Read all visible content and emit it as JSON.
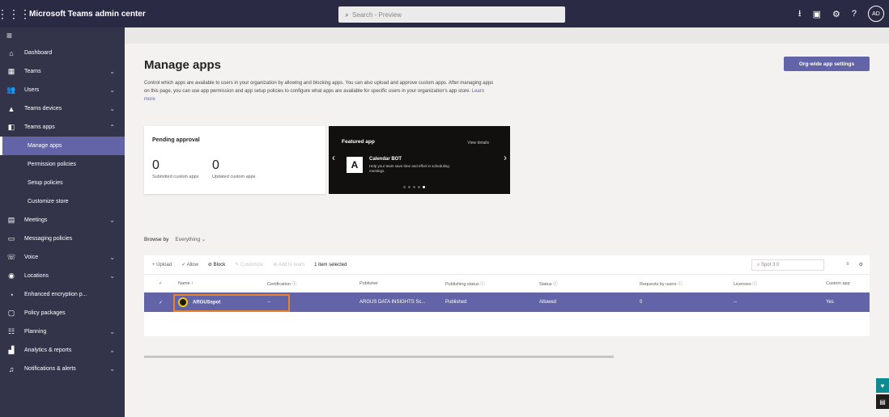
{
  "topbar": {
    "title": "Microsoft Teams admin center",
    "search_placeholder": "Search - Preview",
    "avatar_initials": "AD"
  },
  "sidebar": {
    "items": [
      {
        "label": "Dashboard",
        "icon": "home-icon"
      },
      {
        "label": "Teams",
        "icon": "teams-icon",
        "chevron": true
      },
      {
        "label": "Users",
        "icon": "users-icon",
        "chevron": true
      },
      {
        "label": "Teams devices",
        "icon": "devices-icon",
        "chevron": true
      },
      {
        "label": "Teams apps",
        "icon": "apps-icon",
        "chevron": true,
        "expanded": true
      }
    ],
    "subitems": [
      {
        "label": "Manage apps",
        "active": true
      },
      {
        "label": "Permission policies"
      },
      {
        "label": "Setup policies"
      },
      {
        "label": "Customize store"
      }
    ],
    "items_after": [
      {
        "label": "Meetings",
        "icon": "meetings-icon",
        "chevron": true
      },
      {
        "label": "Messaging policies",
        "icon": "messaging-icon"
      },
      {
        "label": "Voice",
        "icon": "voice-icon",
        "chevron": true
      },
      {
        "label": "Locations",
        "icon": "locations-icon",
        "chevron": true
      },
      {
        "label": "Enhanced encryption p...",
        "icon": "encryption-icon"
      },
      {
        "label": "Policy packages",
        "icon": "policy-icon"
      },
      {
        "label": "Planning",
        "icon": "planning-icon",
        "chevron": true
      },
      {
        "label": "Analytics & reports",
        "icon": "analytics-icon",
        "chevron": true
      },
      {
        "label": "Notifications & alerts",
        "icon": "notifications-icon",
        "chevron": true
      }
    ]
  },
  "main": {
    "title": "Manage apps",
    "org_button": "Org-wide app settings",
    "description": "Control which apps are available to users in your organization by allowing and blocking apps. You can also upload and approve custom apps. After managing apps on this page, you can use app permission and app setup policies to configure what apps are available for specific users in your organization's app store.",
    "learn_more": "Learn more",
    "pending": {
      "title": "Pending approval",
      "submitted_count": "0",
      "submitted_label": "Submitted custom apps",
      "updated_count": "0",
      "updated_label": "Updated custom apps"
    },
    "featured": {
      "title": "Featured app",
      "view_details": "View details",
      "app_name": "Calendar BOT",
      "app_desc": "Help your team save time and effort in scheduling meetings.",
      "logo_letter": "A"
    },
    "browse": {
      "label": "Browse by",
      "value": "Everything"
    },
    "toolbar": {
      "upload": "+ Upload",
      "allow": "Allow",
      "block": "Block",
      "customize": "Customize",
      "add_to_team": "Add to team",
      "selected": "1 item selected",
      "search_placeholder": "Spot 3.0"
    },
    "table": {
      "headers": [
        "Name",
        "Certification",
        "Publisher",
        "Publishing status",
        "Status",
        "Requests by users",
        "Licenses",
        "Custom app"
      ],
      "row": {
        "name": "ARGUSspot",
        "certification": "--",
        "publisher": "ARGUS DATA INSIGHTS Sc...",
        "publishing_status": "Published",
        "status": "Allowed",
        "requests": "0",
        "licenses": "--",
        "custom_app": "Yes"
      }
    }
  },
  "colors": {
    "topbar": "#2b2a45",
    "sidebar": "#33344a",
    "accent": "#6264a7",
    "highlight": "#e8822c"
  }
}
